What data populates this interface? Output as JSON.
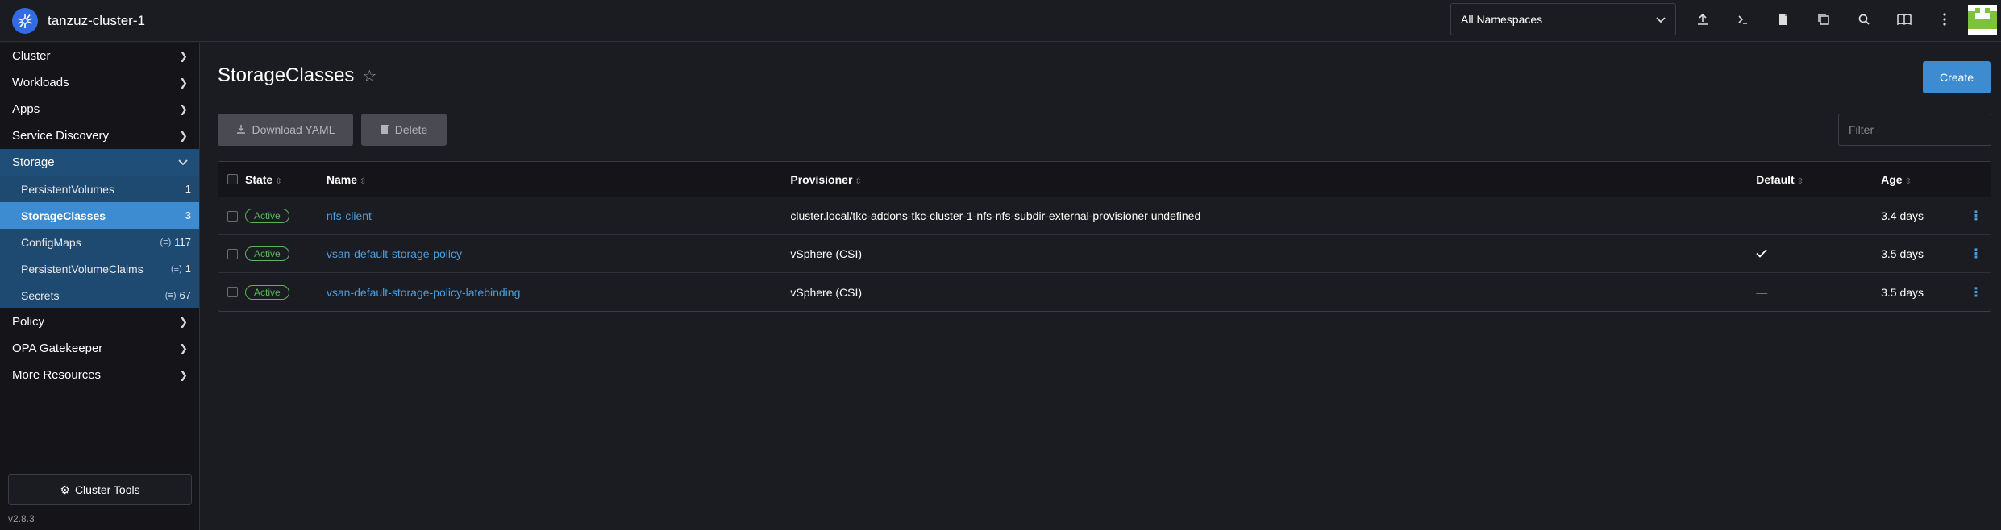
{
  "header": {
    "cluster_name": "tanzuz-cluster-1",
    "namespace_select": "All Namespaces",
    "icons": [
      "upload-icon",
      "terminal-icon",
      "file-icon",
      "copy-config-icon",
      "search-icon",
      "book-icon",
      "more-vertical-icon"
    ]
  },
  "sidebar": {
    "groups_top": [
      {
        "label": "Cluster"
      },
      {
        "label": "Workloads"
      },
      {
        "label": "Apps"
      },
      {
        "label": "Service Discovery"
      }
    ],
    "storage": {
      "label": "Storage",
      "items": [
        {
          "label": "PersistentVolumes",
          "count": "1",
          "namespaced": false
        },
        {
          "label": "StorageClasses",
          "count": "3",
          "namespaced": false
        },
        {
          "label": "ConfigMaps",
          "count": "117",
          "namespaced": true
        },
        {
          "label": "PersistentVolumeClaims",
          "count": "1",
          "namespaced": true
        },
        {
          "label": "Secrets",
          "count": "67",
          "namespaced": true
        }
      ]
    },
    "groups_bottom": [
      {
        "label": "Policy"
      },
      {
        "label": "OPA Gatekeeper"
      },
      {
        "label": "More Resources"
      }
    ],
    "cluster_tools": "Cluster Tools",
    "version": "v2.8.3"
  },
  "main": {
    "title": "StorageClasses",
    "create": "Create",
    "download_yaml": "Download YAML",
    "delete": "Delete",
    "filter_placeholder": "Filter"
  },
  "table": {
    "headers": {
      "state": "State",
      "name": "Name",
      "provisioner": "Provisioner",
      "default": "Default",
      "age": "Age"
    },
    "rows": [
      {
        "state": "Active",
        "name": "nfs-client",
        "provisioner": "cluster.local/tkc-addons-tkc-cluster-1-nfs-nfs-subdir-external-provisioner undefined",
        "default": "—",
        "age": "3.4 days"
      },
      {
        "state": "Active",
        "name": "vsan-default-storage-policy",
        "provisioner": "vSphere (CSI)",
        "default": "✓",
        "age": "3.5 days"
      },
      {
        "state": "Active",
        "name": "vsan-default-storage-policy-latebinding",
        "provisioner": "vSphere (CSI)",
        "default": "—",
        "age": "3.5 days"
      }
    ]
  },
  "colors": {
    "accent": "#3d8bd0",
    "link": "#4a9ee0",
    "active_badge": "#5db35f",
    "sidebar_active": "#1f4e79",
    "background": "#1b1c21"
  }
}
